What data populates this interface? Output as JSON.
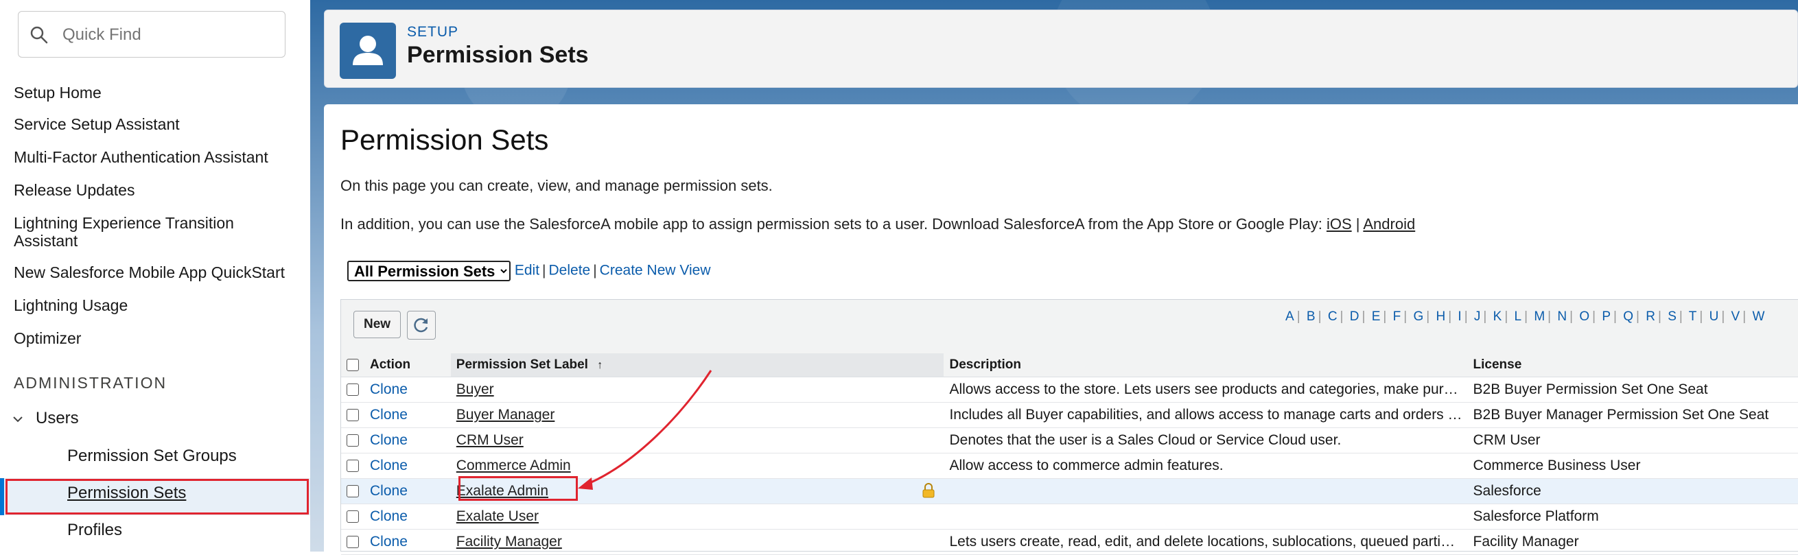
{
  "sidebar": {
    "quick_find_placeholder": "Quick Find",
    "items": [
      {
        "label": "Setup Home"
      },
      {
        "label": "Service Setup Assistant"
      },
      {
        "label": "Multi-Factor Authentication Assistant"
      },
      {
        "label": "Release Updates"
      },
      {
        "label": "Lightning Experience Transition"
      },
      {
        "label": "Assistant"
      },
      {
        "label": "New Salesforce Mobile App QuickStart"
      },
      {
        "label": "Lightning Usage"
      },
      {
        "label": "Optimizer"
      }
    ],
    "section_label": "ADMINISTRATION",
    "users_label": "Users",
    "sub_items": [
      {
        "label": "Permission Set Groups"
      },
      {
        "label": "Permission Sets"
      },
      {
        "label": "Profiles"
      }
    ],
    "active_item": "Permission Sets"
  },
  "header": {
    "kicker": "SETUP",
    "title": "Permission Sets",
    "icon": "user-icon"
  },
  "content": {
    "heading": "Permission Sets",
    "intro_line1": "On this page you can create, view, and manage permission sets.",
    "intro_line2_prefix": "In addition, you can use the SalesforceA mobile app to assign permission sets to a user. Download SalesforceA from the App Store or Google Play: ",
    "ios_link": "iOS",
    "intro_sep": "|",
    "android_link": "Android",
    "view_select_value": "All Permission Sets",
    "view_links": {
      "edit": "Edit",
      "delete": "Delete",
      "create": "Create New View"
    },
    "link_sep": "|"
  },
  "list": {
    "new_button": "New",
    "refresh_icon": "refresh-icon",
    "alphabet": [
      "A",
      "B",
      "C",
      "D",
      "E",
      "F",
      "G",
      "H",
      "I",
      "J",
      "K",
      "L",
      "M",
      "N",
      "O",
      "P",
      "Q",
      "R",
      "S",
      "T",
      "U",
      "V",
      "W"
    ],
    "columns": {
      "action": "Action",
      "label": "Permission Set Label",
      "sort_indicator": "↑",
      "description": "Description",
      "license": "License"
    },
    "rows": [
      {
        "action": "Clone",
        "label": "Buyer",
        "description": "Allows access to the store. Lets users see products and categories, make pur…",
        "license": "B2B Buyer Permission Set One Seat",
        "locked": false
      },
      {
        "action": "Clone",
        "label": "Buyer Manager",
        "description": "Includes all Buyer capabilities, and allows access to manage carts and orders …",
        "license": "B2B Buyer Manager Permission Set One Seat",
        "locked": false
      },
      {
        "action": "Clone",
        "label": "CRM User",
        "description": "Denotes that the user is a Sales Cloud or Service Cloud user.",
        "license": "CRM User",
        "locked": false
      },
      {
        "action": "Clone",
        "label": "Commerce Admin",
        "description": "Allow access to commerce admin features.",
        "license": "Commerce Business User",
        "locked": false
      },
      {
        "action": "Clone",
        "label": "Exalate Admin",
        "description": "",
        "license": "Salesforce",
        "locked": true
      },
      {
        "action": "Clone",
        "label": "Exalate User",
        "description": "",
        "license": "Salesforce Platform",
        "locked": false
      },
      {
        "action": "Clone",
        "label": "Facility Manager",
        "description": "Lets users create, read, edit, and delete locations, sublocations, queued parti…",
        "license": "Facility Manager",
        "locked": false
      }
    ],
    "highlighted_row": "Exalate Admin"
  },
  "colors": {
    "accent": "#0b5cab",
    "annotation": "#e0242f",
    "header_icon_bg": "#2e6aa3"
  }
}
